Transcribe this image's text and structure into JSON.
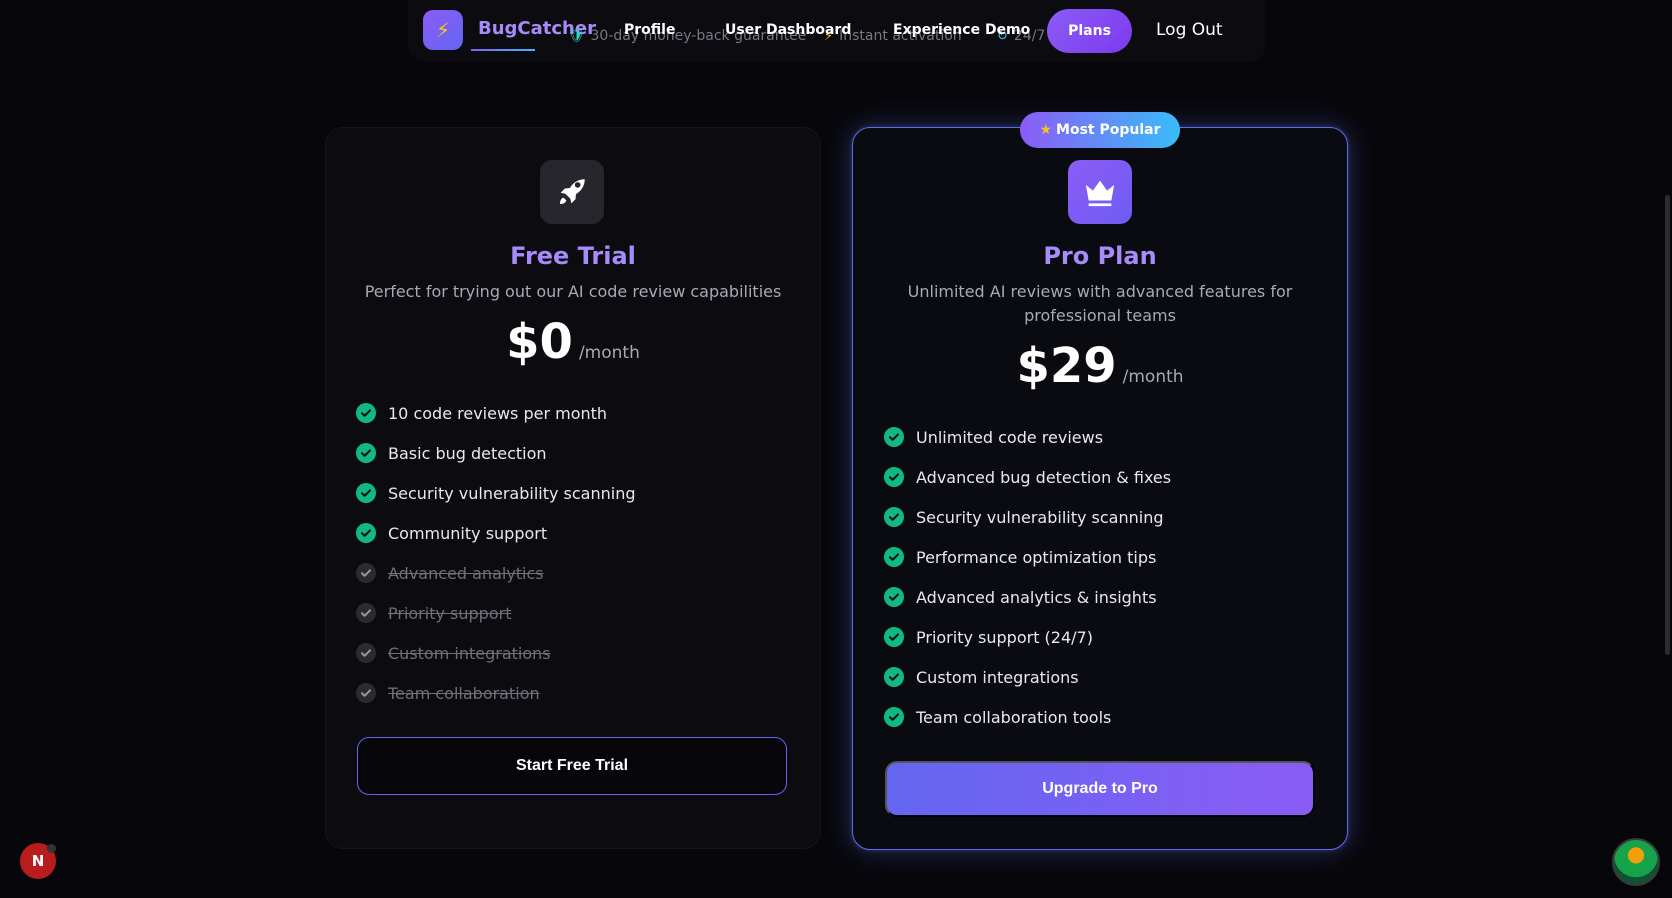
{
  "nav": {
    "logo_icon": "lightning-icon",
    "brand": "BugCatcher",
    "guarantees": [
      {
        "icon": "shield-icon",
        "text": "30-day money-back guarantee"
      },
      {
        "icon": "lightning-icon",
        "text": "Instant activation"
      },
      {
        "icon": "refresh-icon",
        "text": "24/7"
      }
    ],
    "links": [
      "Profile",
      "User Dashboard",
      "Experience Demo"
    ],
    "plans": "Plans",
    "logout": "Log Out"
  },
  "badge": "Most Popular",
  "plans": {
    "free": {
      "icon": "rocket-icon",
      "title": "Free Trial",
      "description": "Perfect for trying out our AI code review capabilities",
      "price": "$0",
      "period": "/month",
      "features": [
        {
          "label": "10 code reviews per month",
          "included": true
        },
        {
          "label": "Basic bug detection",
          "included": true
        },
        {
          "label": "Security vulnerability scanning",
          "included": true
        },
        {
          "label": "Community support",
          "included": true
        },
        {
          "label": "Advanced analytics",
          "included": false
        },
        {
          "label": "Priority support",
          "included": false
        },
        {
          "label": "Custom integrations",
          "included": false
        },
        {
          "label": "Team collaboration",
          "included": false
        }
      ],
      "cta": "Start Free Trial"
    },
    "pro": {
      "icon": "crown-icon",
      "title": "Pro Plan",
      "description": "Unlimited AI reviews with advanced features for professional teams",
      "price": "$29",
      "period": "/month",
      "features": [
        {
          "label": "Unlimited code reviews",
          "included": true
        },
        {
          "label": "Advanced bug detection & fixes",
          "included": true
        },
        {
          "label": "Security vulnerability scanning",
          "included": true
        },
        {
          "label": "Performance optimization tips",
          "included": true
        },
        {
          "label": "Advanced analytics & insights",
          "included": true
        },
        {
          "label": "Priority support (24/7)",
          "included": true
        },
        {
          "label": "Custom integrations",
          "included": true
        },
        {
          "label": "Team collaboration tools",
          "included": true
        }
      ],
      "cta": "Upgrade to Pro"
    }
  },
  "dev_badge": "N",
  "colors": {
    "accent": "#8b5cf6",
    "accent_secondary": "#38bdf8",
    "check": "#10b981",
    "background": "#07070b"
  }
}
